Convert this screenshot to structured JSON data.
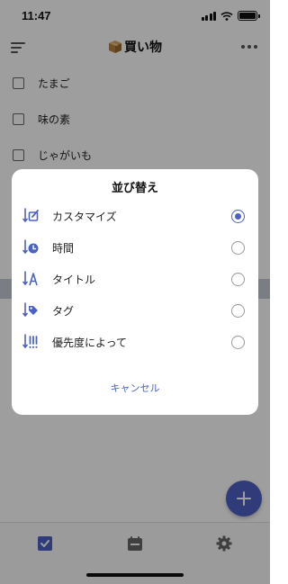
{
  "status_bar": {
    "time": "11:47"
  },
  "nav": {
    "title": "買い物"
  },
  "list_items": [
    {
      "label": "たまご"
    },
    {
      "label": "味の素"
    },
    {
      "label": "じゃがいも"
    }
  ],
  "sort_sheet": {
    "title": "並び替え",
    "options": [
      {
        "label": "カスタマイズ",
        "icon": "custom-sort-icon",
        "selected": true
      },
      {
        "label": "時間",
        "icon": "clock-sort-icon",
        "selected": false
      },
      {
        "label": "タイトル",
        "icon": "title-sort-icon",
        "selected": false
      },
      {
        "label": "タグ",
        "icon": "tag-sort-icon",
        "selected": false
      },
      {
        "label": "優先度によって",
        "icon": "priority-sort-icon",
        "selected": false
      }
    ],
    "cancel_label": "キャンセル"
  },
  "tabbar": {
    "tabs": [
      "tasks-icon",
      "calendar-icon",
      "settings-icon"
    ]
  },
  "colors": {
    "accent": "#4c62c3",
    "overlay": "rgba(0,0,0,0.38)"
  }
}
